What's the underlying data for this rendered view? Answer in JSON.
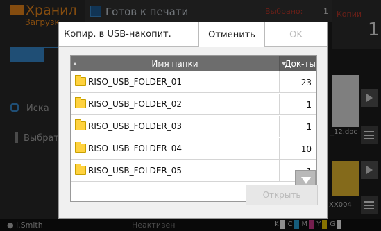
{
  "background": {
    "title": "Хранил",
    "subtitle": "Загрузк",
    "status": "Готов к печати",
    "selected_label": "Выбрано:",
    "selected_count": "1",
    "copies_label": "Копии",
    "copies_value": "1",
    "search_label": "Иска",
    "select_label": "Выбрат",
    "file_1": "_12.doc",
    "file_2": "XX004",
    "user": "l.Smith",
    "state": "Неактивен",
    "toner": [
      {
        "label": "K",
        "color": "#ffffff"
      },
      {
        "label": "C",
        "color": "#29a8e0"
      },
      {
        "label": "M",
        "color": "#d63a8f"
      },
      {
        "label": "Y",
        "color": "#f4d000"
      },
      {
        "label": "G",
        "color": "#ffffff"
      }
    ]
  },
  "dialog": {
    "title": "Копир. в USB-накопит.",
    "cancel_label": "Отменить",
    "ok_label": "OK",
    "open_label": "Открыть",
    "table": {
      "col_name": "Имя папки",
      "col_docs": "Док-ты",
      "rows": [
        {
          "name": "RISO_USB_FOLDER_01",
          "count": "23"
        },
        {
          "name": "RISO_USB_FOLDER_02",
          "count": "1"
        },
        {
          "name": "RISO_USB_FOLDER_03",
          "count": "1"
        },
        {
          "name": "RISO_USB_FOLDER_04",
          "count": "10"
        },
        {
          "name": "RISO_USB_FOLDER_05",
          "count": "1"
        }
      ]
    }
  }
}
